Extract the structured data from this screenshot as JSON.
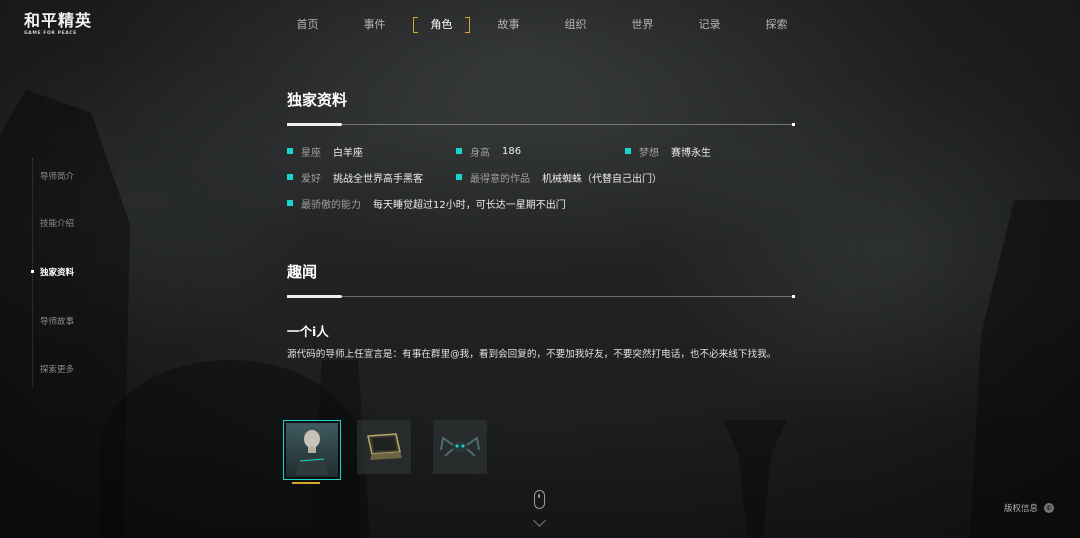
{
  "logo": {
    "main": "和平精英",
    "sub": "GAME FOR PEACE"
  },
  "nav": [
    "首页",
    "事件",
    "角色",
    "故事",
    "组织",
    "世界",
    "记录",
    "探索"
  ],
  "nav_active_index": 2,
  "sidenav": [
    {
      "label": "导师简介",
      "active": false
    },
    {
      "label": "技能介绍",
      "active": false
    },
    {
      "label": "独家资料",
      "active": true
    },
    {
      "label": "导师故事",
      "active": false
    },
    {
      "label": "探索更多",
      "active": false
    }
  ],
  "profile": {
    "title": "独家资料",
    "rows": [
      [
        {
          "label": "星座",
          "value": "白羊座"
        },
        {
          "label": "身高",
          "value": "186"
        },
        {
          "label": "梦想",
          "value": "赛博永生"
        }
      ],
      [
        {
          "label": "爱好",
          "value": "挑战全世界高手黑客"
        },
        {
          "label": "最得意的作品",
          "value": "机械蜘蛛（代替自己出门）"
        }
      ],
      [
        {
          "label": "最骄傲的能力",
          "value": "每天睡觉超过12小时，可长达一星期不出门"
        }
      ]
    ]
  },
  "trivia": {
    "title": "趣闻",
    "story_title": "一个i人",
    "story_text": "源代码的导师上任宣言是：有事在群里@我，看到会回复的，不要加我好友，不要突然打电话，也不必来线下找我。"
  },
  "thumbnails": [
    {
      "icon": "character-portrait-icon",
      "active": true
    },
    {
      "icon": "laptop-icon",
      "active": false
    },
    {
      "icon": "mechanical-spider-icon",
      "active": false
    }
  ],
  "footer": {
    "copyright": "版权信息",
    "copyright_icon": "©"
  },
  "colors": {
    "accent": "#19d5d0",
    "gold": "#d8a52c"
  }
}
